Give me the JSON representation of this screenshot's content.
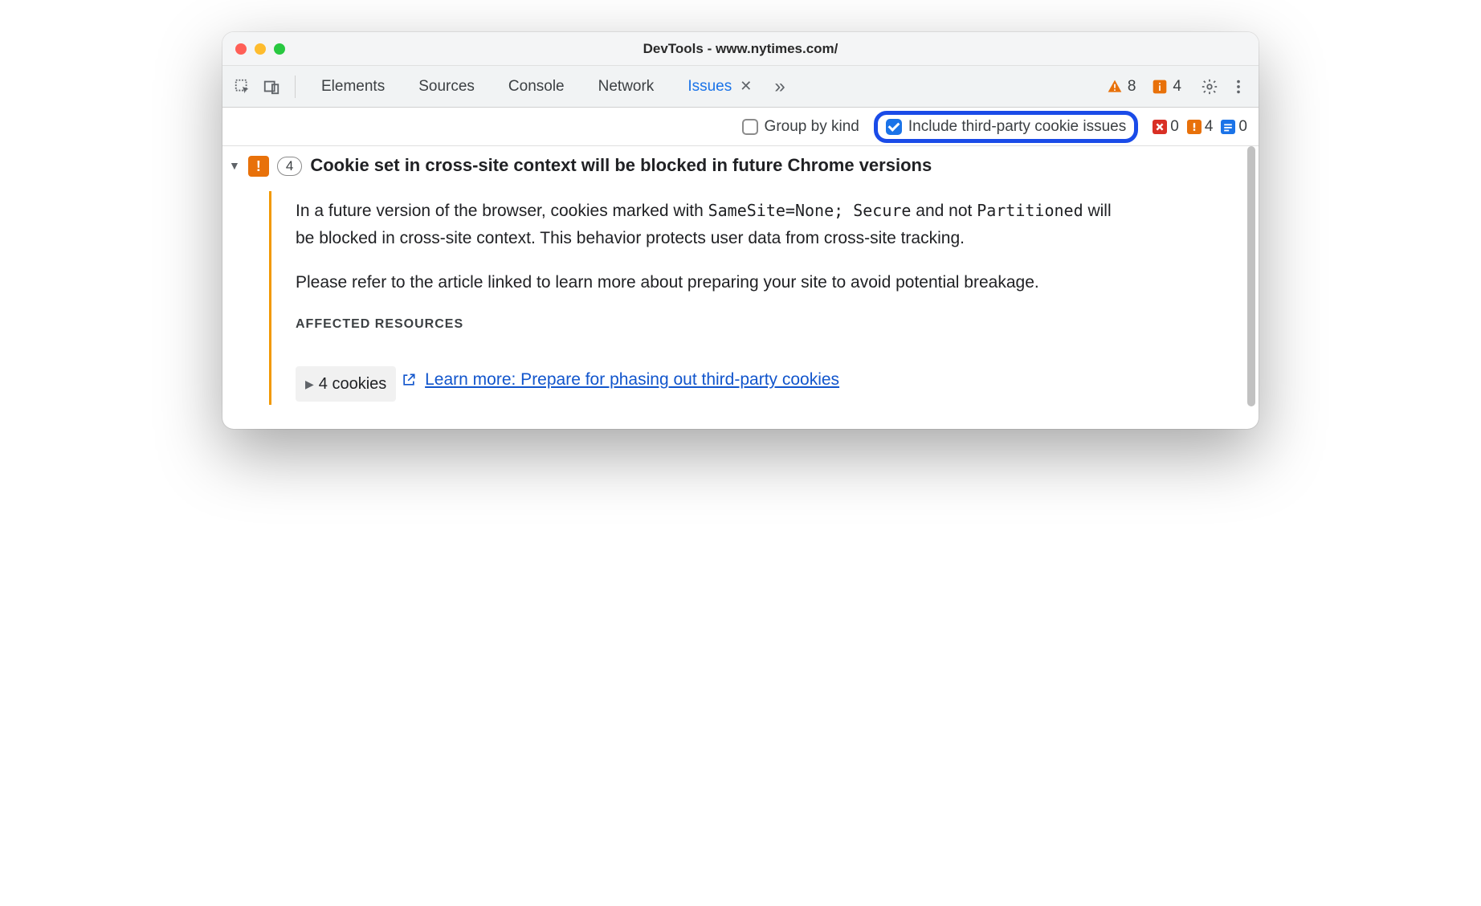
{
  "window": {
    "title": "DevTools - www.nytimes.com/"
  },
  "tabs": {
    "elements": "Elements",
    "sources": "Sources",
    "console": "Console",
    "network": "Network",
    "issues": "Issues"
  },
  "top_badges": {
    "warning_count": "8",
    "info_count": "4"
  },
  "toolbar": {
    "group_by_kind": "Group by kind",
    "include_third_party": "Include third-party cookie issues"
  },
  "issue_counters": {
    "errors": "0",
    "warnings": "4",
    "info": "0"
  },
  "issue": {
    "count": "4",
    "title": "Cookie set in cross-site context will be blocked in future Chrome versions",
    "body_prefix": "In a future version of the browser, cookies marked with ",
    "code1": "SameSite=None; Secure",
    "body_mid": " and not ",
    "code2": "Partitioned",
    "body_suffix": " will be blocked in cross-site context. This behavior protects user data from cross-site tracking.",
    "body2": "Please refer to the article linked to learn more about preparing your site to avoid potential breakage.",
    "affected_label": "AFFECTED RESOURCES",
    "cookies_label": "4 cookies",
    "learn_more": "Learn more: Prepare for phasing out third-party cookies"
  }
}
